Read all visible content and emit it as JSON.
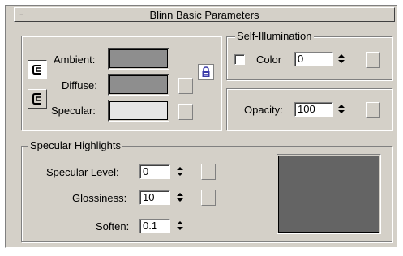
{
  "rollout": {
    "toggle": "-",
    "title": "Blinn Basic Parameters"
  },
  "colors": {
    "ambient": "#8e8e8e",
    "diffuse": "#8e8e8e",
    "specular": "#e5e5e5",
    "highlight_preview": "#646464"
  },
  "basic": {
    "ambient_label": "Ambient:",
    "diffuse_label": "Diffuse:",
    "specular_label": "Specular:",
    "lock_icon": "lock-icon"
  },
  "self_illumination": {
    "legend": "Self-Illumination",
    "color_label": "Color",
    "value": "0",
    "color_checked": false
  },
  "opacity": {
    "label": "Opacity:",
    "value": "100"
  },
  "specular_highlights": {
    "legend": "Specular Highlights",
    "specular_level_label": "Specular Level:",
    "specular_level_value": "0",
    "glossiness_label": "Glossiness:",
    "glossiness_value": "10",
    "soften_label": "Soften:",
    "soften_value": "0.1"
  }
}
